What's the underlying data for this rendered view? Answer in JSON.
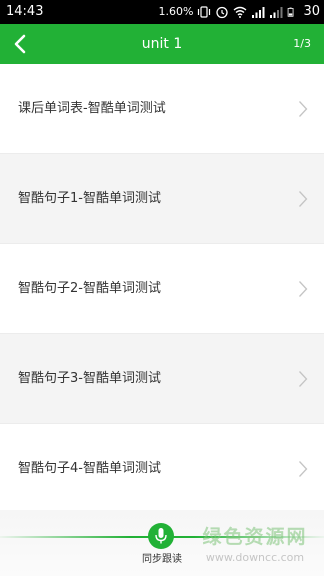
{
  "status_bar": {
    "time": "14:43",
    "speed": "1.60%",
    "battery": "30"
  },
  "app_bar": {
    "title": "unit 1",
    "page": "1/3",
    "bg_color": "#22b136"
  },
  "list": {
    "items": [
      {
        "label": "课后单词表-智酷单词测试"
      },
      {
        "label": "智酷句子1-智酷单词测试"
      },
      {
        "label": "智酷句子2-智酷单词测试"
      },
      {
        "label": "智酷句子3-智酷单词测试"
      },
      {
        "label": "智酷句子4-智酷单词测试"
      }
    ]
  },
  "bottom_bar": {
    "mic_label": "同步跟读"
  },
  "watermark": {
    "text": "绿色资源网",
    "url": "www.downcc.com"
  }
}
